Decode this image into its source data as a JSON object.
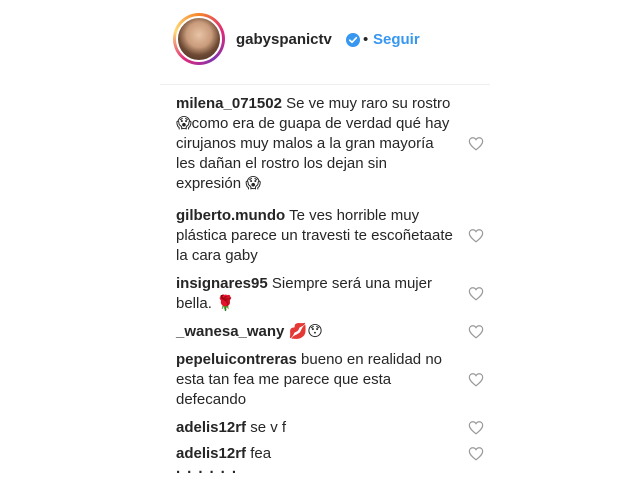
{
  "header": {
    "username": "gabyspanictv",
    "separator": "•",
    "follow_label": "Seguir"
  },
  "comments": [
    {
      "user": "milena_071502",
      "text": "Se ve muy raro su rostro 😱como era de guapa de verdad qué hay cirujanos muy malos a la gran mayoría les dañan el rostro los dejan sin expresión 😱"
    },
    {
      "user": "gilberto.mundo",
      "text": "Te ves horrible muy plástica parece un travesti te escoñetaate la cara gaby"
    },
    {
      "user": "insignares95",
      "text": "Siempre será una mujer bella. 🌹"
    },
    {
      "user": "_wanesa_wany",
      "text": "💋😯"
    },
    {
      "user": "pepeluicontreras",
      "text": "bueno en realidad no esta tan fea me parece que esta defecando"
    },
    {
      "user": "adelis12rf",
      "text": "se v f"
    },
    {
      "user": "adelis12rf",
      "text": "fea"
    }
  ],
  "colors": {
    "link": "#3897f0",
    "text": "#262626",
    "verified": "#3897f0",
    "heart_outline": "#999999"
  },
  "icons": {
    "verified": "verified-badge-icon",
    "like": "heart-outline-icon"
  }
}
